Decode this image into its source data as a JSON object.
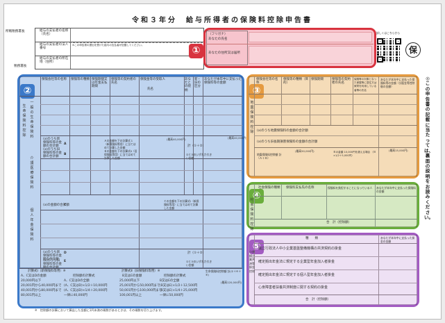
{
  "document": {
    "title": "令和３年分　給与所得者の保険料控除申告書",
    "stamp": "保",
    "side_note": "◎この申告書の記載に当たっては、裏面の説明をお読みください。",
    "qr_caption": "詳しくはこちらから",
    "footnote": "※　控除額の計算において算出した金額に1円未満の端数があるときは、その端数を切り上げます。"
  },
  "header": {
    "tax_office_label": "所轄税務署長",
    "tax_office_suffix": "税務署長",
    "employer_name_label": "給与の支払者の名称（氏名）",
    "employer_number_label": "給与の支払者の法人番号",
    "employer_address_label": "給与の支払者の所在地（住所）",
    "number_note": "※この申告書の提出を受けた給与の支払者が記載してください。"
  },
  "sections": {
    "s1": {
      "number": "①",
      "furigana": "（フリガナ）",
      "name_label": "あなたの氏名",
      "address_label": "あなたの住所又は居所"
    },
    "s2": {
      "number": "②",
      "headers": [
        "保険会社等の名称",
        "保険等の種類",
        "保険期間又は年金支払期間",
        "保険等の契約者の氏名",
        "保険金等の受取人",
        "氏名",
        "あなたとの続柄",
        "新・旧の区分",
        "あなたが本年中に支払った保険料等の金額"
      ],
      "vertical_life": "一般の生命保険料",
      "vertical_care": "介護医療保険料",
      "vertical_pension": "個人年金保険料",
      "vertical_total": "生命保険料控除",
      "new_label": "(a)のうち新保険料等の金額の合計額",
      "old_label": "(a)のうち旧保険料等の金額の合計額",
      "calc_note": "Ａの金額を下の計算式１（新保険料等用）に当てはめて計算した金額",
      "calc_note2": "Ｂの金額を下の計算式Ⅱ（旧保険料等用）に当てはめて計算した金額",
      "max_40k": "(最高40,000円)",
      "max_50k": "(最高50,000円)",
      "max_120k": "(最高120,000円)",
      "sum_label": "計（①＋②）",
      "compare_label": "②と③のいずれか大きい金額",
      "care_label": "(a)の金額の合計額",
      "care_calc": "Ｃの金額を下の計算式Ⅰ（新保険料等用）に当てはめて計算した金額",
      "control_label": "生命保険料控除額 計(①＋④＋⑥)",
      "amount_header": "控除額の計算式",
      "formula_new_title": "計算式Ⅰ（新保険料等用）※",
      "formula_old_title": "計算式Ⅱ（旧保険料等用）※",
      "formula_header_a": "A、C又はDの金額",
      "formula_header_b": "控除額の計算式",
      "formula_header_c": "B又はEの金額",
      "formula_rows_new": [
        [
          "20,000円以下",
          "A、C又はDの全額"
        ],
        [
          "20,001円から40,000円まで",
          "(A、C又はD)×1/2＋10,000円"
        ],
        [
          "40,001円から80,000円まで",
          "(A、C又はD)×1/4＋20,000円"
        ],
        [
          "80,001円以上",
          "一律に40,000円"
        ]
      ],
      "formula_rows_old": [
        [
          "25,000円以下",
          "B又はEの全額"
        ],
        [
          "25,001円から50,000円まで",
          "(B又はE)×1/2＋12,500円"
        ],
        [
          "50,001円から100,000円まで",
          "(B又はE)×1/4＋25,000円"
        ],
        [
          "100,001円以上",
          "一律に50,000円"
        ]
      ],
      "unit": "円",
      "letters": [
        "A",
        "B",
        "C",
        "D",
        "E"
      ]
    },
    "s3": {
      "number": "③",
      "headers": [
        "保険会社等の名称",
        "保険等の種類（目的）",
        "保険期間",
        "保険等の契約者の氏名",
        "保険等の対象となった家屋等に居住又は家財を利用している者等の氏名",
        "あなたとの続柄",
        "地震保険料又は旧長期損害保険料区分",
        "あなたが本年中に支払った保険料等の金額（分配金等控除後の金額）"
      ],
      "vertical": "地震保険料控除",
      "earthquake_label": "(a)のうち地震保険料の金額の合計額",
      "old_long_label": "(a)のうち旧長期損害保険料の金額の合計額",
      "control_label": "地震保険料控除額 計（Ａ＋Ｂ）",
      "max_50k": "(最高50,000円)",
      "max_15k": "(最高15,000円)",
      "formula": "Ｂの金額 10,000円を超える場合 （Ｂ×1/2＋5,000円）",
      "unit": "円"
    },
    "s4": {
      "number": "④",
      "headers": [
        "社会保険の種類",
        "保険料支払先の名称",
        "保険料を負担することになっている人",
        "氏名",
        "あなたとの続柄",
        "あなたが本年中に支払った保険料の金額"
      ],
      "vertical": "社会保険料控除",
      "total_label": "合　計（控除額）",
      "unit": "円"
    },
    "s5": {
      "number": "⑤",
      "header_kind": "種　　類",
      "header_amount": "あなたが本年中に支払った掛金の金額",
      "vertical": "小規模企業共済等掛金控除",
      "rows": [
        "独立行政法人中小企業基盤整備機構の共済契約の掛金",
        "確定拠出年金法に規定する企業型年金加入者掛金",
        "確定拠出年金法に規定する個人型年金加入者掛金",
        "心身障害者扶養共済制度に関する契約の掛金"
      ],
      "total_label": "合　計（控除額）",
      "unit": "円"
    }
  },
  "colors": {
    "s1_fill": "#f7c4cd",
    "s1_border": "#d8333f",
    "s2_fill": "#bfd4ef",
    "s2_border": "#3b79c9",
    "s3_fill": "#f5dcb8",
    "s3_border": "#e59a3f",
    "s4_fill": "#d6e9c3",
    "s4_border": "#6aae3c",
    "s5_fill": "#eee1f4",
    "s5_border": "#a35cc2"
  }
}
